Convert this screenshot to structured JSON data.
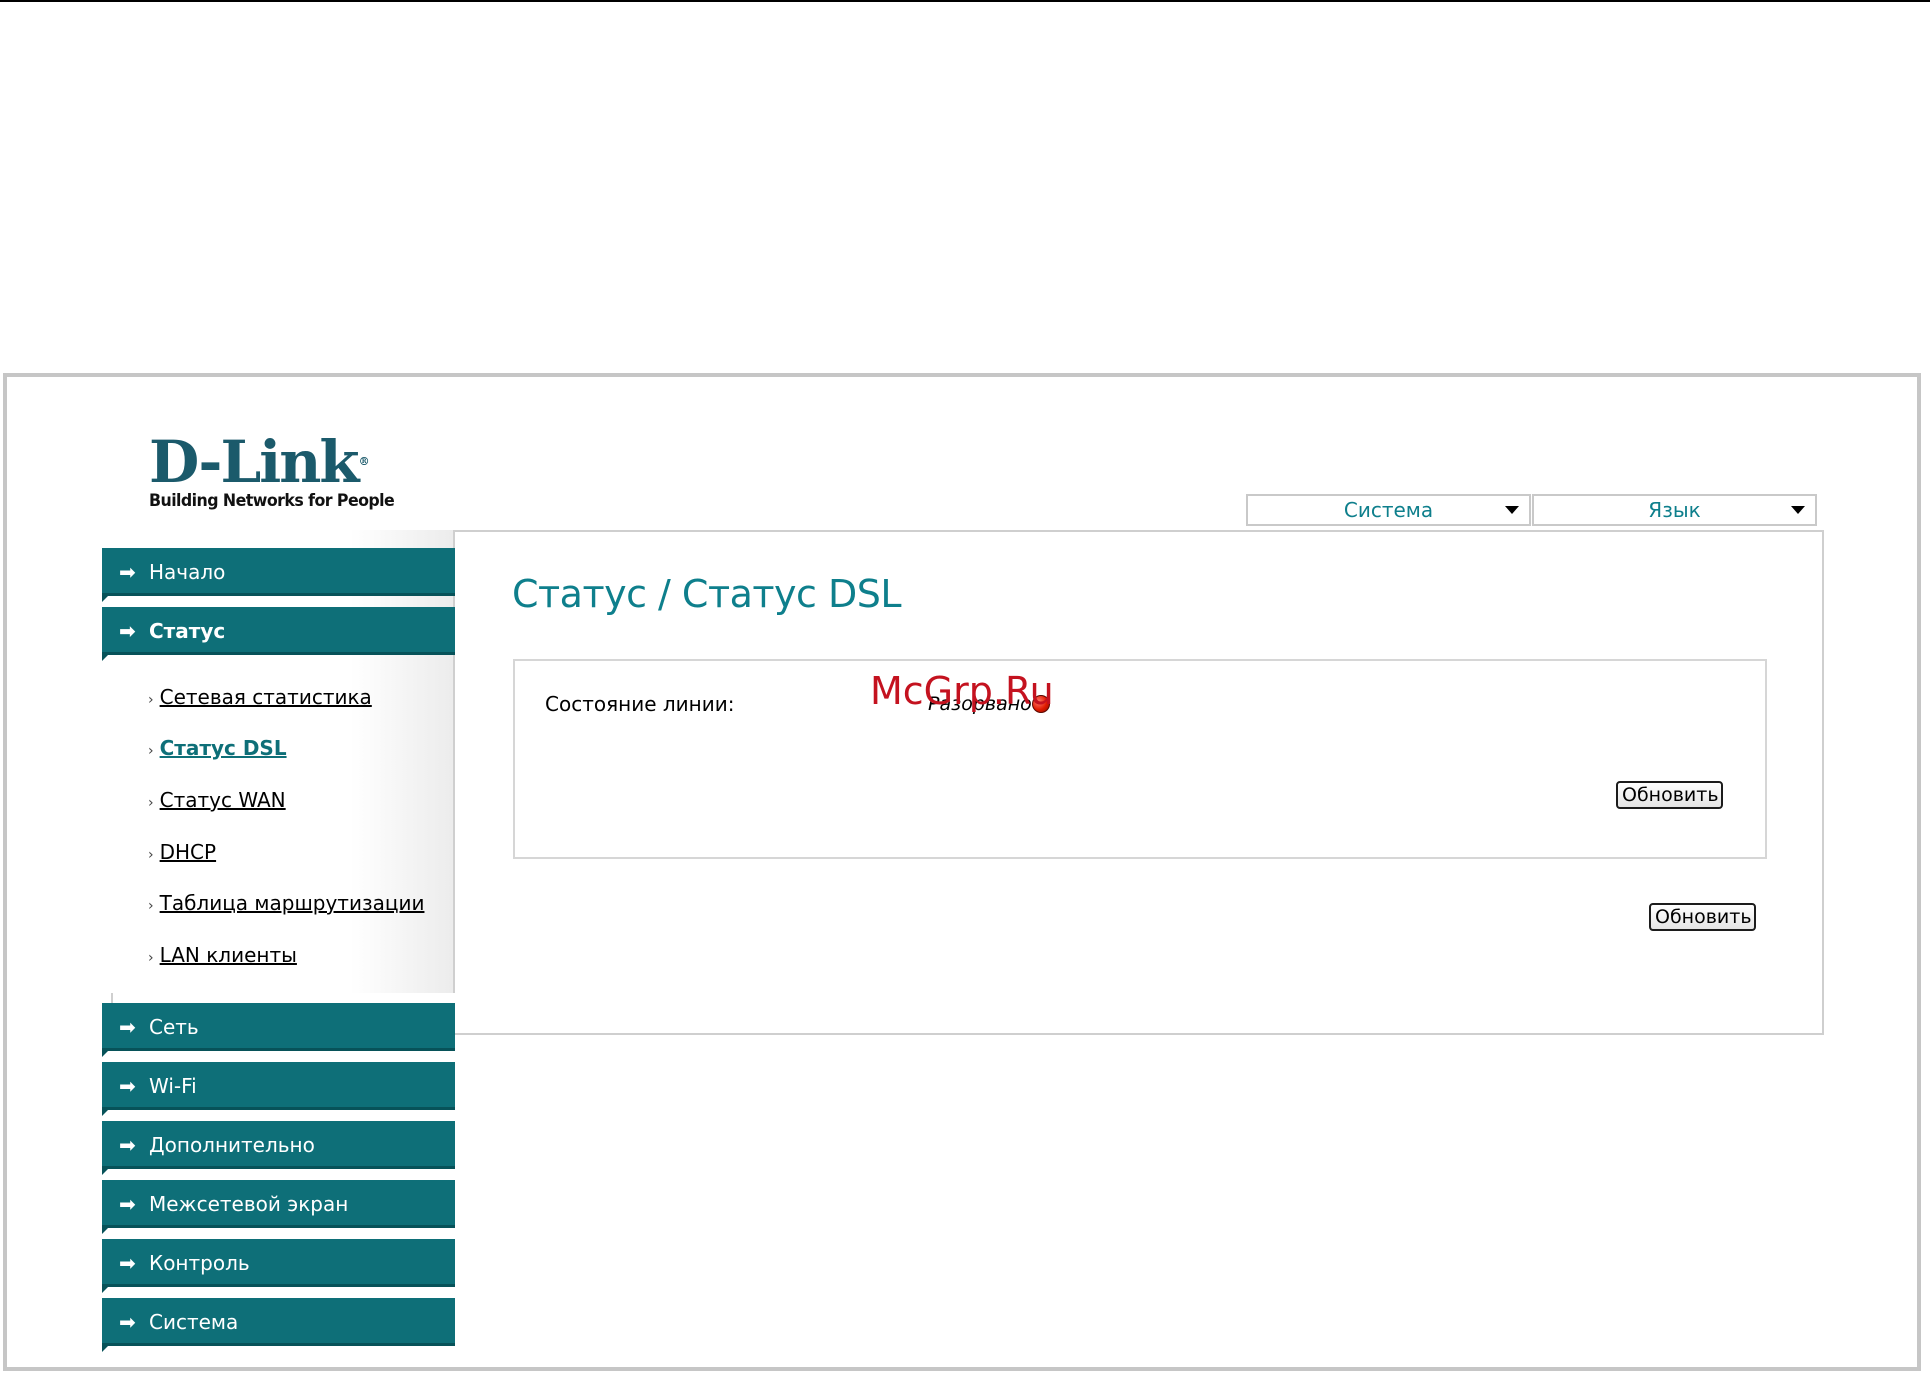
{
  "logo": {
    "brand": "D-Link",
    "reg": "®",
    "tagline": "Building Networks for People"
  },
  "top_menu": [
    {
      "label": "Система"
    },
    {
      "label": "Язык"
    }
  ],
  "sidebar": {
    "top_items": [
      {
        "label": "Начало",
        "active": false
      },
      {
        "label": "Статус",
        "active": true
      }
    ],
    "sub_items": [
      {
        "label": "Сетевая статистика",
        "current": false
      },
      {
        "label": "Статус DSL",
        "current": true
      },
      {
        "label": "Статус WAN",
        "current": false
      },
      {
        "label": "DHCP",
        "current": false
      },
      {
        "label": "Таблица маршрутизации",
        "current": false
      },
      {
        "label": "LAN клиенты",
        "current": false
      }
    ],
    "bottom_items": [
      {
        "label": "Сеть"
      },
      {
        "label": "Wi-Fi"
      },
      {
        "label": "Дополнительно"
      },
      {
        "label": "Межсетевой экран"
      },
      {
        "label": "Контроль"
      },
      {
        "label": "Система"
      }
    ]
  },
  "main": {
    "title": "Статус / Статус DSL",
    "line_state_label": "Состояние линии:",
    "line_state_value": "Разорвано",
    "status_color": "#e01a00",
    "refresh_inner": "Обновить",
    "refresh_outer": "Обновить"
  },
  "watermark": "McGrp.Ru",
  "colors": {
    "accent": "#0e6f78",
    "title": "#0e7f8c"
  }
}
